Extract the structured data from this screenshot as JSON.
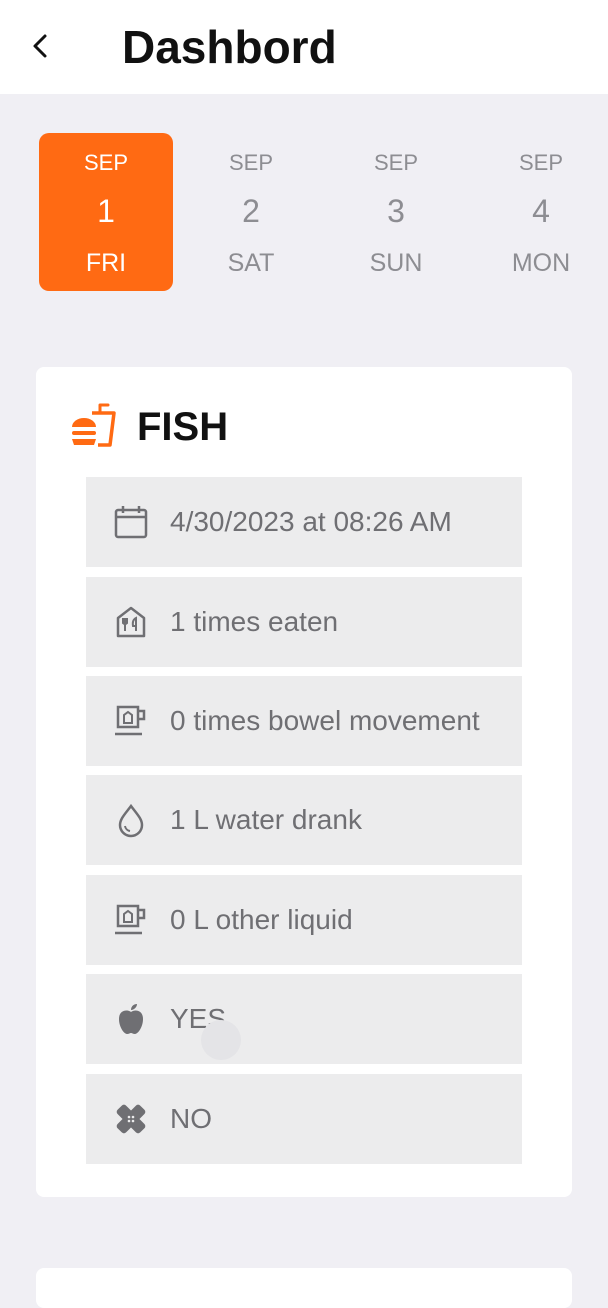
{
  "header": {
    "title": "Dashbord"
  },
  "days": [
    {
      "month": "SEP",
      "day": "1",
      "weekday": "FRI",
      "active": true
    },
    {
      "month": "SEP",
      "day": "2",
      "weekday": "SAT",
      "active": false
    },
    {
      "month": "SEP",
      "day": "3",
      "weekday": "SUN",
      "active": false
    },
    {
      "month": "SEP",
      "day": "4",
      "weekday": "MON",
      "active": false
    }
  ],
  "card": {
    "title": "FISH",
    "rows": [
      {
        "icon": "calendar-icon",
        "text": "4/30/2023 at 08:26 AM"
      },
      {
        "icon": "restaurant-icon",
        "text": "1 times eaten"
      },
      {
        "icon": "cup-icon",
        "text": "0 times bowel movement"
      },
      {
        "icon": "water-drop-icon",
        "text": "1 L water drank"
      },
      {
        "icon": "cup-icon",
        "text": "0 L other liquid"
      },
      {
        "icon": "apple-icon",
        "text": "YES"
      },
      {
        "icon": "bandage-icon",
        "text": "NO"
      }
    ]
  },
  "colors": {
    "accent": "#ff6a13",
    "background": "#f0eff4",
    "row": "#ececed"
  }
}
